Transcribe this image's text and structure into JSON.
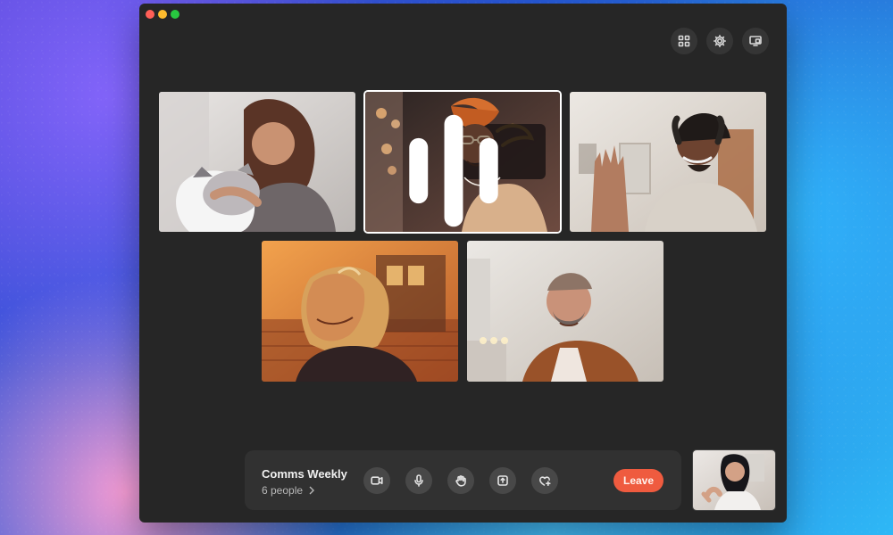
{
  "window": {
    "traffic_lights": [
      "close",
      "minimize",
      "zoom"
    ],
    "top_tools": [
      {
        "name": "layout",
        "icon": "grid-icon"
      },
      {
        "name": "settings",
        "icon": "gear-icon"
      },
      {
        "name": "screen",
        "icon": "screen-share-icon"
      }
    ]
  },
  "participants": [
    {
      "id": "participant-1",
      "speaking": false
    },
    {
      "id": "participant-2",
      "speaking": true
    },
    {
      "id": "participant-3",
      "speaking": false
    },
    {
      "id": "participant-4",
      "speaking": false
    },
    {
      "id": "participant-5",
      "speaking": false
    }
  ],
  "meeting": {
    "title": "Comms Weekly",
    "people": "6 people"
  },
  "controls": {
    "buttons": [
      {
        "name": "camera",
        "icon": "camera-icon"
      },
      {
        "name": "microphone",
        "icon": "microphone-icon"
      },
      {
        "name": "raise-hand",
        "icon": "hand-icon"
      },
      {
        "name": "share",
        "icon": "share-icon"
      },
      {
        "name": "reaction",
        "icon": "heart-plus-icon"
      }
    ],
    "leave_label": "Leave"
  },
  "colors": {
    "window_bg": "#262626",
    "bar_bg": "#313131",
    "leave_bg": "#ef5b3f"
  }
}
